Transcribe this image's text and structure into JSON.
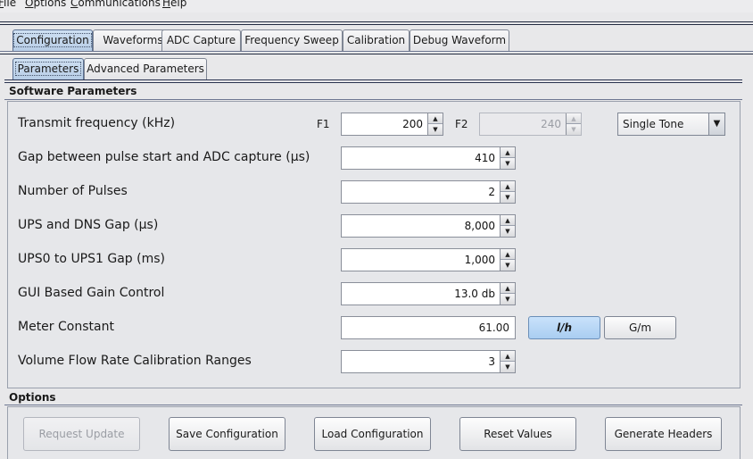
{
  "menu": [
    {
      "label": "File",
      "mnemonic": "F",
      "rest": "ile"
    },
    {
      "label": "Options",
      "mnemonic": "O",
      "rest": "ptions"
    },
    {
      "label": "Communications",
      "mnemonic": "C",
      "rest": "ommunications"
    },
    {
      "label": "Help",
      "mnemonic": "H",
      "rest": "elp"
    }
  ],
  "tabs": [
    {
      "label": "Configuration",
      "active": true
    },
    {
      "label": "Waveforms"
    },
    {
      "label": "ADC Capture"
    },
    {
      "label": "Frequency Sweep"
    },
    {
      "label": "Calibration"
    },
    {
      "label": "Debug Waveform"
    }
  ],
  "subtabs": [
    {
      "label": "Parameters",
      "active": true
    },
    {
      "label": "Advanced Parameters"
    }
  ],
  "software_parameters": {
    "title": "Software Parameters",
    "transmit_frequency": {
      "label": "Transmit frequency (kHz)",
      "f1_label": "F1",
      "f1_value": "200",
      "f2_label": "F2",
      "f2_value": "240",
      "mode": "Single Tone"
    },
    "gap_pulse_adc": {
      "label": "Gap between pulse start and ADC capture (µs)",
      "value": "410"
    },
    "num_pulses": {
      "label": "Number of Pulses",
      "value": "2"
    },
    "ups_dns_gap": {
      "label": "UPS and DNS Gap (µs)",
      "value": "8,000"
    },
    "ups0_ups1_gap": {
      "label": "UPS0 to UPS1 Gap (ms)",
      "value": "1,000"
    },
    "gain_control": {
      "label": "GUI Based Gain Control",
      "value": "13.0 db"
    },
    "meter_constant": {
      "label": "Meter Constant",
      "value": "61.00",
      "unit_lh": "l/h",
      "unit_gm": "G/m"
    },
    "vfr_ranges": {
      "label": "Volume Flow Rate Calibration Ranges",
      "value": "3"
    }
  },
  "options": {
    "title": "Options",
    "request_update": "Request Update",
    "save_configuration": "Save Configuration",
    "load_configuration": "Load Configuration",
    "reset_values": "Reset Values",
    "generate_headers": "Generate Headers"
  },
  "colors": {
    "accent_selected": "#a9cdf1",
    "section_rule": "#2a3350"
  }
}
